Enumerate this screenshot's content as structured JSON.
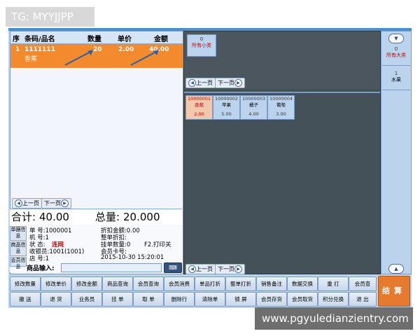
{
  "watermarks": {
    "top": "TG: MYYJJPP",
    "bottom": "www.pgyuledianzientry.com"
  },
  "order_table": {
    "headers": [
      "序",
      "条码/品名",
      "数量",
      "单价",
      "金额"
    ],
    "rows": [
      {
        "seq": "1",
        "barcode": "1111111",
        "name": "香蕉",
        "qty": "20",
        "price": "2.00",
        "amount": "40.00"
      }
    ],
    "prev_page": "上一页",
    "next_page": "下一页"
  },
  "totals": {
    "sum_label": "合计:",
    "sum_value": "40.00",
    "qty_label": "总量:",
    "qty_value": "20.000"
  },
  "info": {
    "tabs": [
      "单据信息",
      "商品信息",
      "会员信息"
    ],
    "order_no": "单  号:1000001",
    "machine_no": "机  号:1",
    "status_label": "状  态:",
    "status_value": "连网",
    "cashier": "收银员:1001(1001)",
    "store": "店  号:1",
    "discount_amount": "折扣金额:0.00",
    "whole_discount": "整单折扣:",
    "hold_qty": "挂单数量:0",
    "print_hint": "F2.打印关",
    "member_card": "会员卡号:",
    "datetime": "2015-10-30 15:20:01",
    "input_label": "商品输入:",
    "input_value": "",
    "keyboard_icon": "keyboard-icon"
  },
  "subcategories": [
    {
      "num": "0",
      "label": "所有小类"
    }
  ],
  "products": [
    {
      "code": "10000001",
      "name": "香蕉",
      "price": "2.00",
      "selected": true
    },
    {
      "code": "10000002",
      "name": "苹果",
      "price": "5.00",
      "selected": false
    },
    {
      "code": "10000003",
      "name": "橘子",
      "price": "4.00",
      "selected": false
    },
    {
      "code": "10000004",
      "name": "葡萄",
      "price": "3.00",
      "selected": false
    }
  ],
  "mid_pager": {
    "prev": "上一页",
    "next": "下一页"
  },
  "categories": [
    {
      "num": "0",
      "label": "所有大类",
      "selected": true
    },
    {
      "num": "1",
      "label": "水果",
      "selected": false
    }
  ],
  "function_buttons": {
    "row1": [
      "修改数量",
      "修改单价",
      "修改金额",
      "商品查询",
      "会员查询",
      "会员消费",
      "单品打折",
      "整单打折",
      "销售备注",
      "数据交换",
      "重 打",
      "会员查"
    ],
    "row2": [
      "撤 送",
      "退 货",
      "业务员",
      "挂 单",
      "取 单",
      "删除行",
      "清除单",
      "锁 屏",
      "会员存货",
      "会员取货",
      "积分兑换",
      "退 出"
    ],
    "checkout": "结算"
  },
  "colors": {
    "selected_row": "#f38a2d",
    "checkout": "#e67a2e",
    "panel_dark": "#455159",
    "status_red": "#cc0000"
  }
}
